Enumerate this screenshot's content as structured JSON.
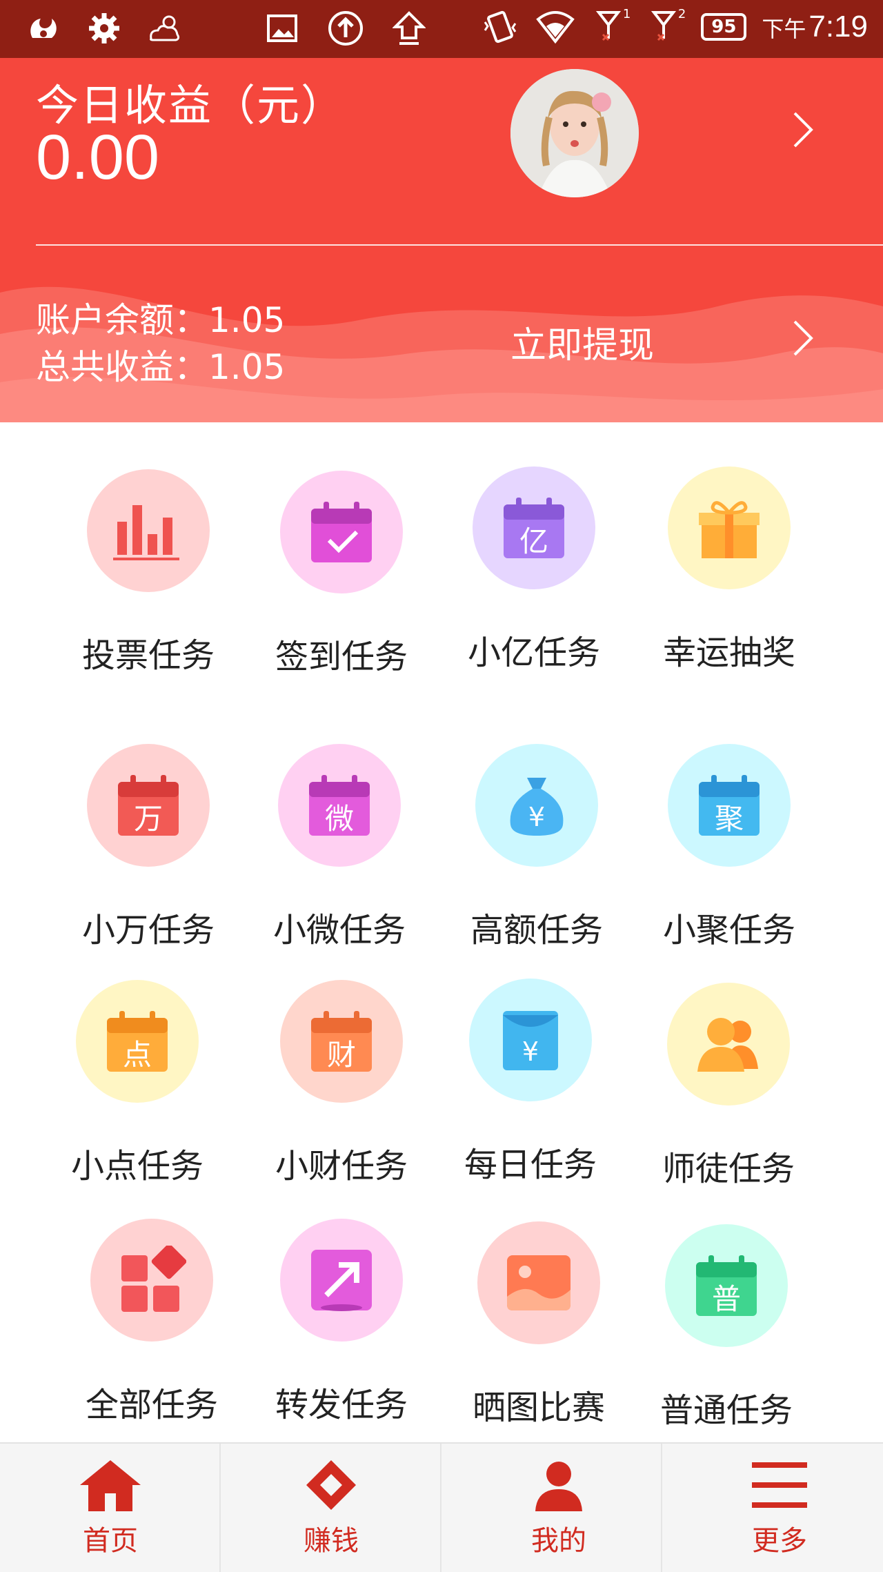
{
  "status_bar": {
    "battery": "95",
    "ampm": "下午",
    "time": "7:19",
    "sim1": "1",
    "sim2": "2",
    "left_icons": [
      "uc-browser-icon",
      "gear-icon",
      "cloud-sun-icon"
    ],
    "mid_icons": [
      "image-icon",
      "upload-circle-icon",
      "upload-arrow-icon"
    ],
    "right_icons": [
      "vibrate-icon",
      "wifi-icon",
      "signal-icon",
      "signal-icon"
    ]
  },
  "header": {
    "today_label": "今日收益（元）",
    "today_value": "0.00",
    "balance_text": "账户余额：1.05",
    "total_text": "总共收益：1.05",
    "withdraw_label": "立即提现",
    "colors": {
      "background": "#f5473d",
      "wave_light": "#fb7d74",
      "wave_mid": "#f8655b"
    }
  },
  "tasks": [
    {
      "label": "投票任务",
      "icon": "bar-chart-icon",
      "bg": "#ffd2d2",
      "fg": "#ef5350",
      "glyph": ""
    },
    {
      "label": "签到任务",
      "icon": "calendar-check-icon",
      "bg": "#ffd0f2",
      "fg": "#e14fd8",
      "glyph": ""
    },
    {
      "label": "小亿任务",
      "icon": "calendar-yi-icon",
      "bg": "#e6d6ff",
      "fg": "#a878f2",
      "glyph": "亿"
    },
    {
      "label": "幸运抽奖",
      "icon": "gift-icon",
      "bg": "#fff6c4",
      "fg": "#ffad38",
      "glyph": ""
    },
    {
      "label": "小万任务",
      "icon": "calendar-wan-icon",
      "bg": "#ffd2d2",
      "fg": "#f25a55",
      "glyph": "万"
    },
    {
      "label": "小微任务",
      "icon": "calendar-wei-icon",
      "bg": "#ffd0f2",
      "fg": "#e35bdc",
      "glyph": "微"
    },
    {
      "label": "高额任务",
      "icon": "money-bag-icon",
      "bg": "#ccf8ff",
      "fg": "#4ab5f3",
      "glyph": "¥"
    },
    {
      "label": "小聚任务",
      "icon": "calendar-ju-icon",
      "bg": "#ccf8ff",
      "fg": "#43b9f0",
      "glyph": "聚"
    },
    {
      "label": "小点任务",
      "icon": "calendar-dian-icon",
      "bg": "#fff6c4",
      "fg": "#ffac3a",
      "glyph": "点"
    },
    {
      "label": "小财任务",
      "icon": "calendar-cai-icon",
      "bg": "#ffd6cc",
      "fg": "#ff8a52",
      "glyph": "财"
    },
    {
      "label": "每日任务",
      "icon": "red-packet-icon",
      "bg": "#ccf8ff",
      "fg": "#41b6ef",
      "glyph": "¥"
    },
    {
      "label": "师徒任务",
      "icon": "users-icon",
      "bg": "#fff6c4",
      "fg": "#ffae3b",
      "glyph": ""
    },
    {
      "label": "全部任务",
      "icon": "grid-blocks-icon",
      "bg": "#ffd2d2",
      "fg": "#f2565a",
      "glyph": ""
    },
    {
      "label": "转发任务",
      "icon": "share-arrow-icon",
      "bg": "#ffd0f2",
      "fg": "#e35bdc",
      "glyph": ""
    },
    {
      "label": "晒图比赛",
      "icon": "picture-icon",
      "bg": "#ffd2d2",
      "fg": "#ff7a52",
      "glyph": ""
    },
    {
      "label": "普通任务",
      "icon": "calendar-pu-icon",
      "bg": "#ccfff0",
      "fg": "#3fd58f",
      "glyph": "普"
    }
  ],
  "bottom_nav": [
    {
      "label": "首页",
      "icon": "home-icon"
    },
    {
      "label": "赚钱",
      "icon": "diamond-icon"
    },
    {
      "label": "我的",
      "icon": "user-icon"
    },
    {
      "label": "更多",
      "icon": "menu-icon"
    }
  ]
}
